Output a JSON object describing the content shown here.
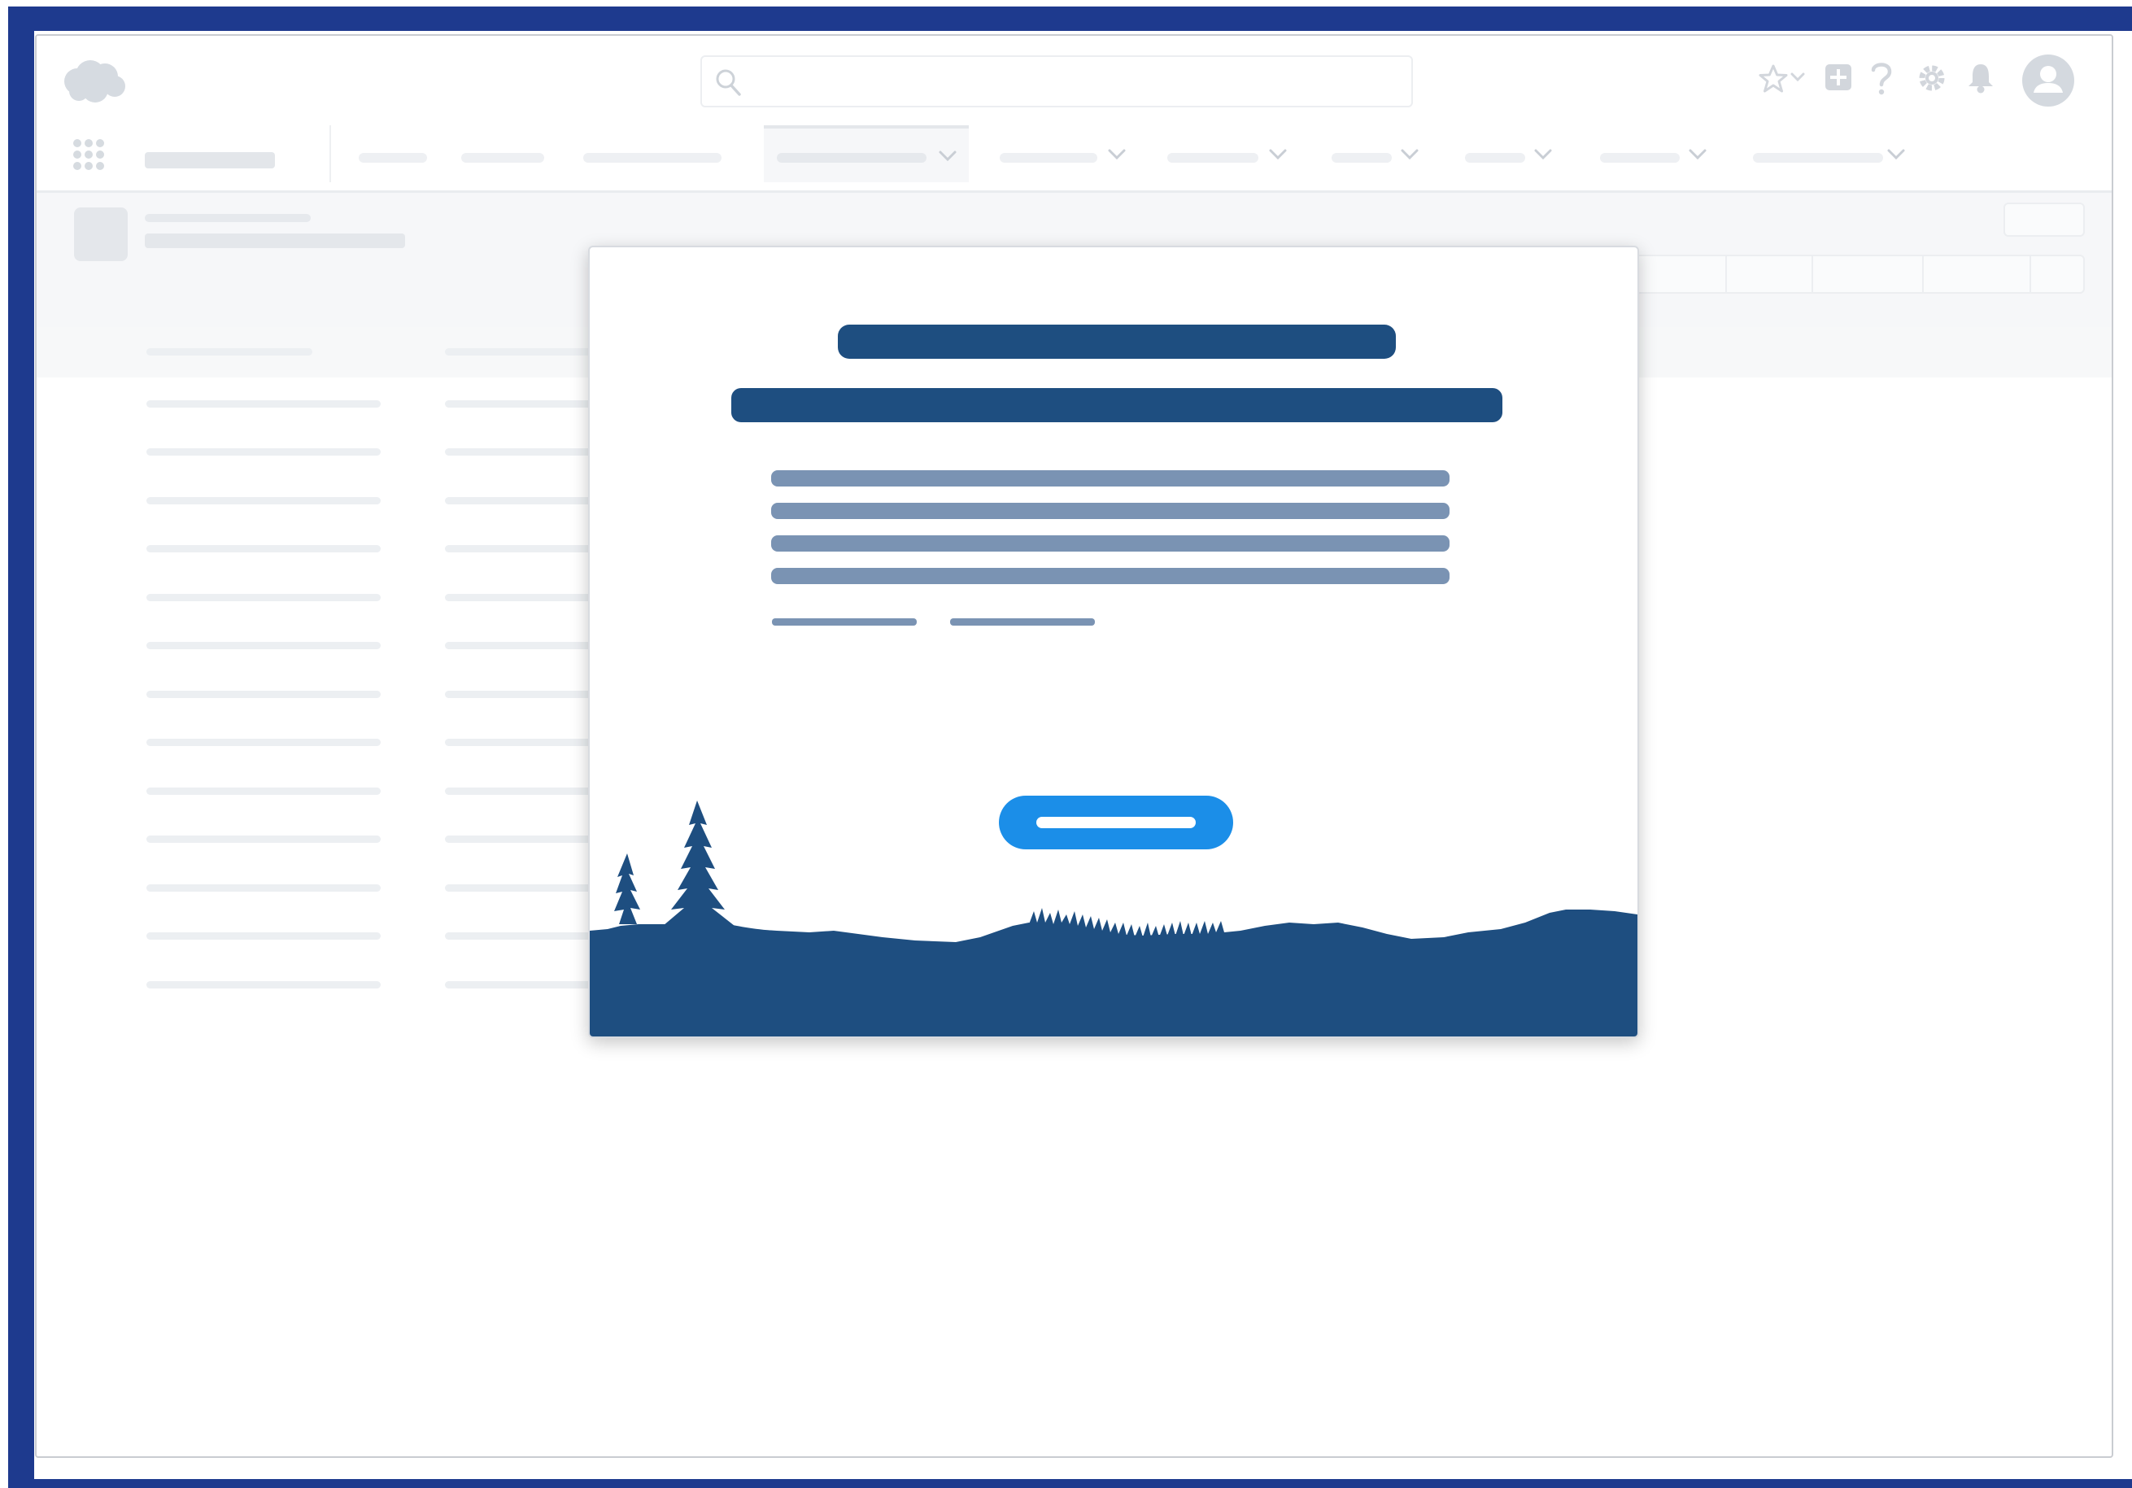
{
  "app": {
    "title": "",
    "logo": "cloud-logo",
    "brand_color": "#1e3a8e"
  },
  "header": {
    "search_placeholder": "",
    "icons": [
      "search-icon",
      "star-icon",
      "chevron-down-icon",
      "plus-icon",
      "help-icon",
      "gear-icon",
      "bell-icon",
      "avatar-icon"
    ]
  },
  "nav": {
    "app_name": "",
    "tab_count": 11,
    "active_tab_index": 3
  },
  "modal": {
    "heading": "",
    "subheading": "",
    "body": "",
    "links": [
      "",
      ""
    ],
    "cta_label": "",
    "colors": {
      "heading": "#1e4e80",
      "body_text": "#7a93b3",
      "cta": "#1b8ee8",
      "scenery": "#1e4e80"
    }
  },
  "background": {
    "list_rows": 13,
    "skeleton_color": "#eceff2"
  }
}
